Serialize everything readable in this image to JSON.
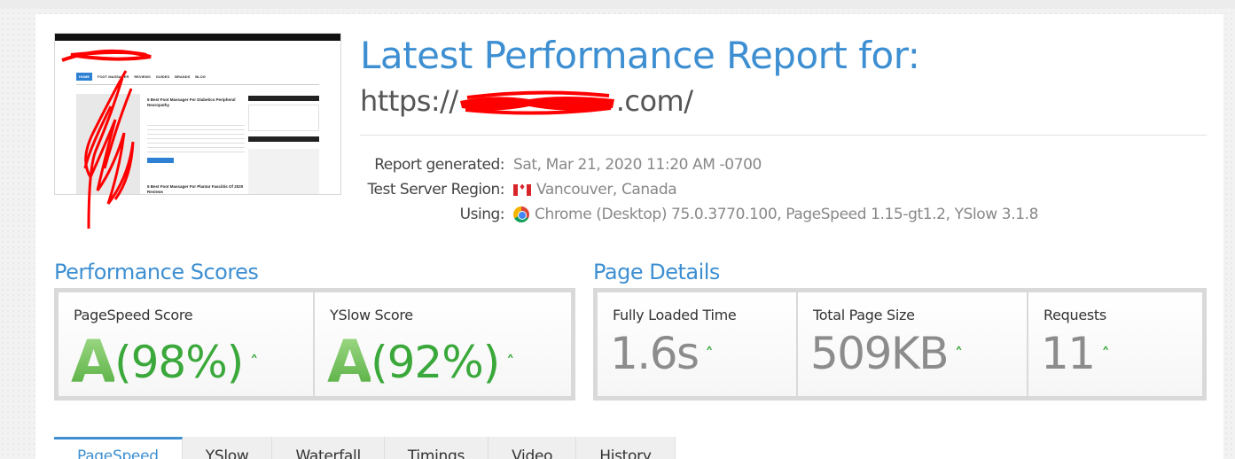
{
  "header": {
    "title": "Latest Performance Report for:",
    "url_prefix": "https://",
    "url_suffix": ".com/"
  },
  "thumbnail": {
    "menu": [
      "HOME",
      "FOOT MASSAGER",
      "REVIEWS",
      "GUIDES",
      "BRANDS",
      "BLOG"
    ],
    "post1_title": "5 Best Foot Massager For Diabetics Peripheral Neuropathy",
    "post2_title": "5 Best Foot Massager For Plantar Fasciitis Of 2020 Reviews"
  },
  "meta": {
    "report_label": "Report generated:",
    "report_value": "Sat, Mar 21, 2020 11:20 AM -0700",
    "region_label": "Test Server Region:",
    "region_value": "Vancouver, Canada",
    "using_label": "Using:",
    "using_value": "Chrome (Desktop) 75.0.3770.100, PageSpeed 1.15-gt1.2, YSlow 3.1.8",
    "region_icon": "canada-flag-icon",
    "browser_icon": "chrome-icon"
  },
  "performance": {
    "title": "Performance Scores",
    "pagespeed": {
      "label": "PageSpeed Score",
      "grade": "A",
      "pct": "(98%)"
    },
    "yslow": {
      "label": "YSlow Score",
      "grade": "A",
      "pct": "(92%)"
    }
  },
  "details": {
    "title": "Page Details",
    "loaded": {
      "label": "Fully Loaded Time",
      "value": "1.6s"
    },
    "size": {
      "label": "Total Page Size",
      "value": "509KB"
    },
    "requests": {
      "label": "Requests",
      "value": "11"
    }
  },
  "caret": "˄",
  "tabs": [
    "PageSpeed",
    "YSlow",
    "Waterfall",
    "Timings",
    "Video",
    "History"
  ],
  "colors": {
    "accent": "#3d8fd2",
    "good": "#3aa83a",
    "redaction": "#ff0000"
  }
}
